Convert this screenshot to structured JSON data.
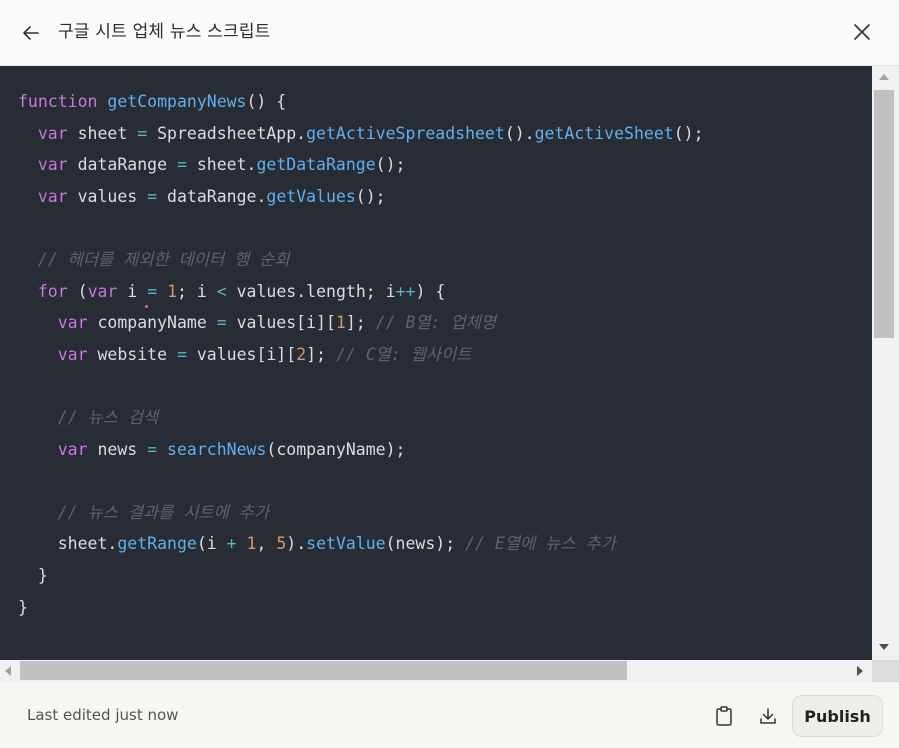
{
  "header": {
    "title": "구글 시트 업체 뉴스 스크립트",
    "back_icon": "arrow-left-icon",
    "close_icon": "close-icon"
  },
  "code": {
    "language": "javascript",
    "lines": [
      [
        {
          "t": "function",
          "c": "kw"
        },
        {
          "t": " "
        },
        {
          "t": "getCompanyNews",
          "c": "fn"
        },
        {
          "t": "() {"
        }
      ],
      [
        {
          "t": "  "
        },
        {
          "t": "var",
          "c": "kw"
        },
        {
          "t": " sheet "
        },
        {
          "t": "=",
          "c": "op"
        },
        {
          "t": " SpreadsheetApp."
        },
        {
          "t": "getActiveSpreadsheet",
          "c": "fn"
        },
        {
          "t": "()."
        },
        {
          "t": "getActiveSheet",
          "c": "fn"
        },
        {
          "t": "();"
        }
      ],
      [
        {
          "t": "  "
        },
        {
          "t": "var",
          "c": "kw"
        },
        {
          "t": " dataRange "
        },
        {
          "t": "=",
          "c": "op"
        },
        {
          "t": " sheet."
        },
        {
          "t": "getDataRange",
          "c": "fn"
        },
        {
          "t": "();"
        }
      ],
      [
        {
          "t": "  "
        },
        {
          "t": "var",
          "c": "kw"
        },
        {
          "t": " values "
        },
        {
          "t": "=",
          "c": "op"
        },
        {
          "t": " dataRange."
        },
        {
          "t": "getValues",
          "c": "fn"
        },
        {
          "t": "();"
        }
      ],
      [],
      [
        {
          "t": "  "
        },
        {
          "t": "// 헤더를 제외한 데이터 행 순회",
          "c": "cm"
        }
      ],
      [
        {
          "t": "  "
        },
        {
          "t": "for",
          "c": "kw"
        },
        {
          "t": " ("
        },
        {
          "t": "var",
          "c": "kw"
        },
        {
          "t": " i "
        },
        {
          "t": "=",
          "c": "op"
        },
        {
          "t": " "
        },
        {
          "t": "1",
          "c": "num"
        },
        {
          "t": "; i "
        },
        {
          "t": "<",
          "c": "op"
        },
        {
          "t": " values.length; i"
        },
        {
          "t": "++",
          "c": "op"
        },
        {
          "t": ") {"
        }
      ],
      [
        {
          "t": "    "
        },
        {
          "t": "var",
          "c": "kw"
        },
        {
          "t": " companyName "
        },
        {
          "t": "=",
          "c": "op"
        },
        {
          "t": " values[i]["
        },
        {
          "t": "1",
          "c": "num"
        },
        {
          "t": "]; "
        },
        {
          "t": "// B열: 업체명",
          "c": "cm"
        }
      ],
      [
        {
          "t": "    "
        },
        {
          "t": "var",
          "c": "kw"
        },
        {
          "t": " website "
        },
        {
          "t": "=",
          "c": "op"
        },
        {
          "t": " values[i]["
        },
        {
          "t": "2",
          "c": "num"
        },
        {
          "t": "]; "
        },
        {
          "t": "// C열: 웹사이트",
          "c": "cm"
        }
      ],
      [],
      [
        {
          "t": "    "
        },
        {
          "t": "// 뉴스 검색",
          "c": "cm"
        }
      ],
      [
        {
          "t": "    "
        },
        {
          "t": "var",
          "c": "kw"
        },
        {
          "t": " news "
        },
        {
          "t": "=",
          "c": "op"
        },
        {
          "t": " "
        },
        {
          "t": "searchNews",
          "c": "fn"
        },
        {
          "t": "(companyName);"
        }
      ],
      [],
      [
        {
          "t": "    "
        },
        {
          "t": "// 뉴스 결과를 시트에 추가",
          "c": "cm"
        }
      ],
      [
        {
          "t": "    sheet."
        },
        {
          "t": "getRange",
          "c": "fn"
        },
        {
          "t": "(i "
        },
        {
          "t": "+",
          "c": "op"
        },
        {
          "t": " "
        },
        {
          "t": "1",
          "c": "num"
        },
        {
          "t": ", "
        },
        {
          "t": "5",
          "c": "num"
        },
        {
          "t": ")."
        },
        {
          "t": "setValue",
          "c": "fn"
        },
        {
          "t": "(news); "
        },
        {
          "t": "// E열에 뉴스 추가",
          "c": "cm"
        }
      ],
      [
        {
          "t": "  }"
        }
      ],
      [
        {
          "t": "}"
        }
      ]
    ]
  },
  "footer": {
    "status": "Last edited just now",
    "copy_icon": "clipboard-icon",
    "download_icon": "download-icon",
    "publish_label": "Publish"
  },
  "colors": {
    "code_bg": "#282c34",
    "keyword": "#c678dd",
    "function": "#61afef",
    "number": "#d19a66",
    "operator": "#56b6c2",
    "comment": "#5c6370"
  }
}
